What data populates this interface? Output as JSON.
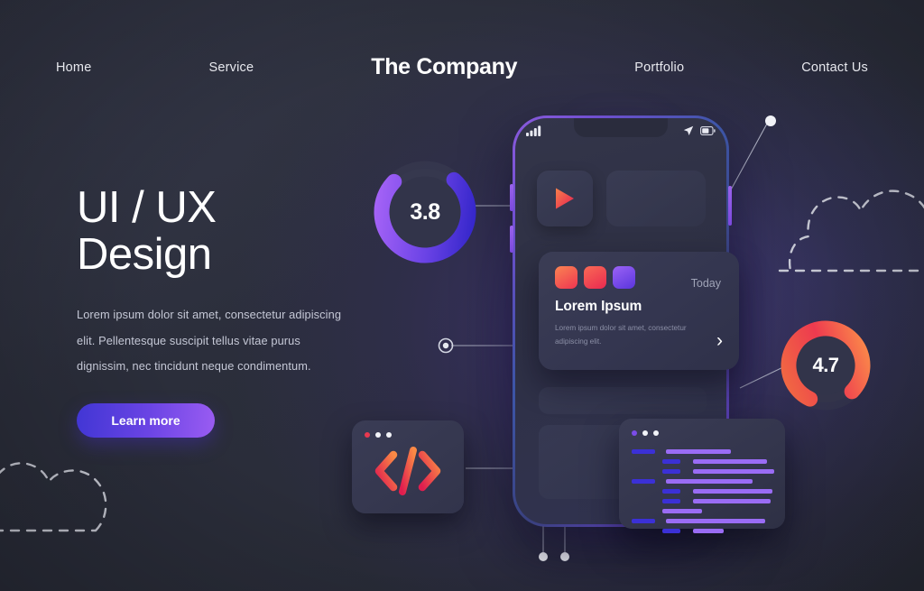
{
  "nav": {
    "brand": "The Company",
    "links_left": [
      {
        "label": "Home",
        "name": "nav-link-home"
      },
      {
        "label": "Service",
        "name": "nav-link-service"
      }
    ],
    "links_right": [
      {
        "label": "Portfolio",
        "name": "nav-link-portfolio"
      },
      {
        "label": "Contact Us",
        "name": "nav-link-contact-us"
      }
    ]
  },
  "hero": {
    "title_line1": "UI / UX",
    "title_line2": "Design",
    "paragraph": "Lorem ipsum dolor sit amet, consectetur adipiscing elit. Pellentesque suscipit tellus vitae purus dignissim, nec tincidunt neque condimentum.",
    "cta_label": "Learn more"
  },
  "gauges": [
    {
      "name": "gauge-rating-38",
      "value": "3.8",
      "accent_from": "#9a5cf2",
      "accent_to": "#3a2fd0",
      "sweep_deg": 272,
      "start_deg": 320
    },
    {
      "name": "gauge-rating-47",
      "value": "4.7",
      "accent_from": "#f2673f",
      "accent_to": "#e01d4f",
      "sweep_deg": 290,
      "start_deg": 60
    }
  ],
  "phone": {
    "status": {
      "signal_icon": "signal-bars-icon",
      "location_icon": "location-arrow-icon",
      "battery_icon": "battery-icon"
    },
    "play_icon": "play-icon"
  },
  "card": {
    "today_label": "Today",
    "title": "Lorem Ipsum",
    "subtitle": "Lorem ipsum dolor sit amet, consectetur adipiscing elit.",
    "chevron_icon": "chevron-right-icon",
    "swatches": [
      "#f5663c",
      "#ec3a52",
      "#7b4ce8"
    ]
  },
  "code_card": {
    "glyph": "</>",
    "dots": [
      "#e8384f",
      "#ffffff",
      "#ffffff"
    ]
  },
  "editor": {
    "dots": [
      "#7b4ce8",
      "#ffffff",
      "#ffffff"
    ],
    "tag_color": "#3b30d6",
    "text_color": "#9a6cf5",
    "lines": [
      {
        "indent": 0,
        "tag": 26,
        "gap": 12,
        "text": 72
      },
      {
        "indent": 34,
        "tag": 20,
        "gap": 14,
        "text": 82
      },
      {
        "indent": 34,
        "tag": 20,
        "gap": 14,
        "text": 90
      },
      {
        "indent": 0,
        "tag": 26,
        "gap": 12,
        "text": 96
      },
      {
        "indent": 34,
        "tag": 20,
        "gap": 14,
        "text": 88
      },
      {
        "indent": 34,
        "tag": 20,
        "gap": 14,
        "text": 86
      },
      {
        "indent": 34,
        "tag": 0,
        "gap": 0,
        "text": 44
      },
      {
        "indent": 0,
        "tag": 26,
        "gap": 12,
        "text": 110
      },
      {
        "indent": 34,
        "tag": 20,
        "gap": 14,
        "text": 34
      }
    ]
  },
  "decor": {
    "cloud_top_right": "dashed-cloud-outline",
    "cloud_bottom_left": "dashed-cloud-outline"
  }
}
